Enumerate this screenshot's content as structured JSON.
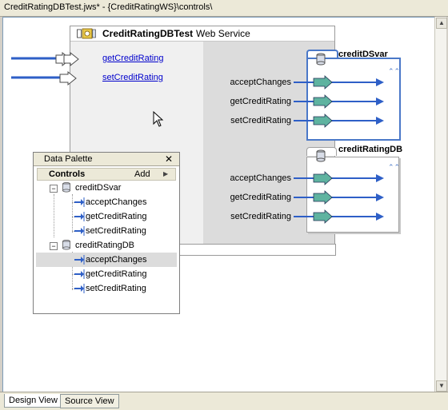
{
  "window": {
    "title": "CreditRatingDBTest.jws* - {CreditRatingWS}\\controls\\"
  },
  "service": {
    "name": "CreditRatingDBTest",
    "type": "Web Service",
    "operations": [
      "getCreditRating",
      "setCreditRating"
    ]
  },
  "controls": [
    {
      "name": "creditDSvar",
      "methods": [
        "acceptChanges",
        "getCreditRating",
        "setCreditRating"
      ]
    },
    {
      "name": "creditRatingDB",
      "methods": [
        "acceptChanges",
        "getCreditRating",
        "setCreditRating"
      ]
    }
  ],
  "palette": {
    "title": "Data Palette",
    "close": "✕",
    "section": "Controls",
    "add": "Add",
    "tree": [
      {
        "name": "creditDSvar",
        "children": [
          "acceptChanges",
          "getCreditRating",
          "setCreditRating"
        ]
      },
      {
        "name": "creditRatingDB",
        "children": [
          "acceptChanges",
          "getCreditRating",
          "setCreditRating"
        ]
      }
    ],
    "selected": "creditRatingDB.acceptChanges"
  },
  "tabs": [
    "Design View",
    "Source View"
  ],
  "colors": {
    "accent": "#4a78c8",
    "arrow": "#2e5fc7",
    "op_fill": "#5fb3a0",
    "link": "#0000cc"
  }
}
